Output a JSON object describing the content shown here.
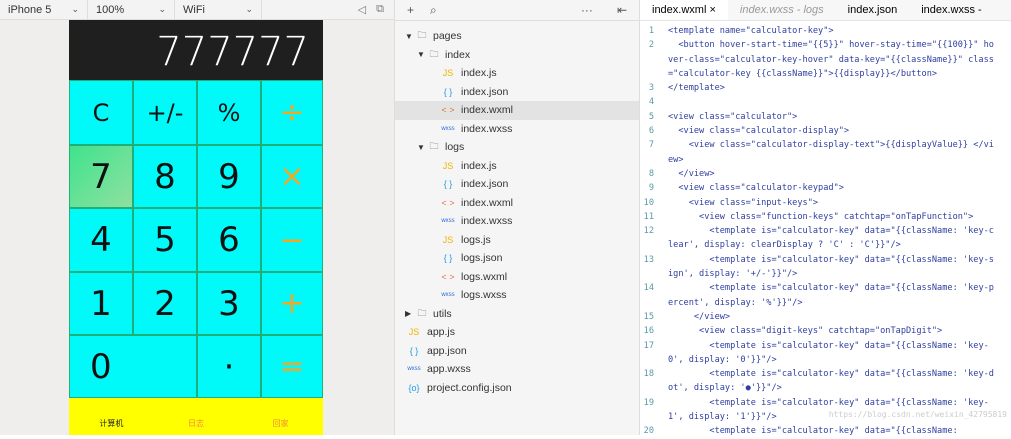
{
  "simulator": {
    "device": "iPhone 5",
    "zoom": "100%",
    "network": "WiFi"
  },
  "calculator": {
    "display": "777777",
    "keys": [
      "C",
      "+/-",
      "%",
      "÷",
      "7",
      "8",
      "9",
      "×",
      "4",
      "5",
      "6",
      "−",
      "1",
      "2",
      "3",
      "+",
      "0",
      "·",
      "="
    ],
    "tabbar": [
      "计算机",
      "日志",
      "回家"
    ],
    "colors": {
      "keys": "#00fafa",
      "display": "#1f1f1f",
      "tabbar": "#ffff00",
      "operator": "#f5a623"
    }
  },
  "tree": {
    "items": [
      {
        "label": "pages",
        "type": "folder",
        "depth": 0
      },
      {
        "label": "index",
        "type": "folder",
        "depth": 1
      },
      {
        "label": "index.js",
        "type": "js",
        "depth": 2
      },
      {
        "label": "index.json",
        "type": "json",
        "depth": 2
      },
      {
        "label": "index.wxml",
        "type": "wxml",
        "depth": 2,
        "active": true
      },
      {
        "label": "index.wxss",
        "type": "wxss",
        "depth": 2
      },
      {
        "label": "logs",
        "type": "folder",
        "depth": 1
      },
      {
        "label": "index.js",
        "type": "js",
        "depth": 2
      },
      {
        "label": "index.json",
        "type": "json",
        "depth": 2
      },
      {
        "label": "index.wxml",
        "type": "wxml",
        "depth": 2
      },
      {
        "label": "index.wxss",
        "type": "wxss",
        "depth": 2
      },
      {
        "label": "logs.js",
        "type": "js",
        "depth": 2
      },
      {
        "label": "logs.json",
        "type": "json",
        "depth": 2
      },
      {
        "label": "logs.wxml",
        "type": "wxml",
        "depth": 2
      },
      {
        "label": "logs.wxss",
        "type": "wxss",
        "depth": 2
      },
      {
        "label": "utils",
        "type": "folder-closed",
        "depth": 0
      },
      {
        "label": "app.js",
        "type": "js",
        "depth": 0
      },
      {
        "label": "app.json",
        "type": "json",
        "depth": 0
      },
      {
        "label": "app.wxss",
        "type": "wxss",
        "depth": 0
      },
      {
        "label": "project.config.json",
        "type": "config",
        "depth": 0
      }
    ]
  },
  "editor": {
    "tabs": [
      "index.wxml ×",
      "index.wxss - logs",
      "index.json",
      "index.wxss -"
    ],
    "lines": [
      {
        "n": "1",
        "t": "<template name=\"calculator-key\">"
      },
      {
        "n": "2",
        "t": "  <button hover-start-time=\"{{5}}\" hover-stay-time=\"{{100}}\" hover-class=\"calculator-key-hover\" data-key=\"{{className}}\" class=\"calculator-key {{className}}\">{{display}}</button>"
      },
      {
        "n": "3",
        "t": "</template>"
      },
      {
        "n": "4",
        "t": ""
      },
      {
        "n": "5",
        "t": "<view class=\"calculator\">"
      },
      {
        "n": "6",
        "t": "  <view class=\"calculator-display\">"
      },
      {
        "n": "7",
        "t": "    <view class=\"calculator-display-text\">{{displayValue}} </view>"
      },
      {
        "n": "8",
        "t": "  </view>"
      },
      {
        "n": "9",
        "t": "  <view class=\"calculator-keypad\">"
      },
      {
        "n": "10",
        "t": "    <view class=\"input-keys\">"
      },
      {
        "n": "11",
        "t": "      <view class=\"function-keys\" catchtap=\"onTapFunction\">"
      },
      {
        "n": "12",
        "t": "        <template is=\"calculator-key\" data=\"{{className: 'key-clear', display: clearDisplay ? 'C' : 'C'}}\"/>"
      },
      {
        "n": "13",
        "t": "        <template is=\"calculator-key\" data=\"{{className: 'key-sign', display: '+/-'}}\"/>"
      },
      {
        "n": "14",
        "t": "        <template is=\"calculator-key\" data=\"{{className: 'key-percent', display: '%'}}\"/>"
      },
      {
        "n": "15",
        "t": "     </view>"
      },
      {
        "n": "16",
        "t": "      <view class=\"digit-keys\" catchtap=\"onTapDigit\">"
      },
      {
        "n": "17",
        "t": "        <template is=\"calculator-key\" data=\"{{className: 'key-0', display: '0'}}\"/>"
      },
      {
        "n": "18",
        "t": "        <template is=\"calculator-key\" data=\"{{className: 'key-dot', display: '●'}}\"/>"
      },
      {
        "n": "19",
        "t": "        <template is=\"calculator-key\" data=\"{{className: 'key-1', display: '1'}}\"/>"
      },
      {
        "n": "20",
        "t": "        <template is=\"calculator-key\" data=\"{{className:"
      }
    ],
    "watermark": "https://blog.csdn.net/weixin_42795819"
  }
}
